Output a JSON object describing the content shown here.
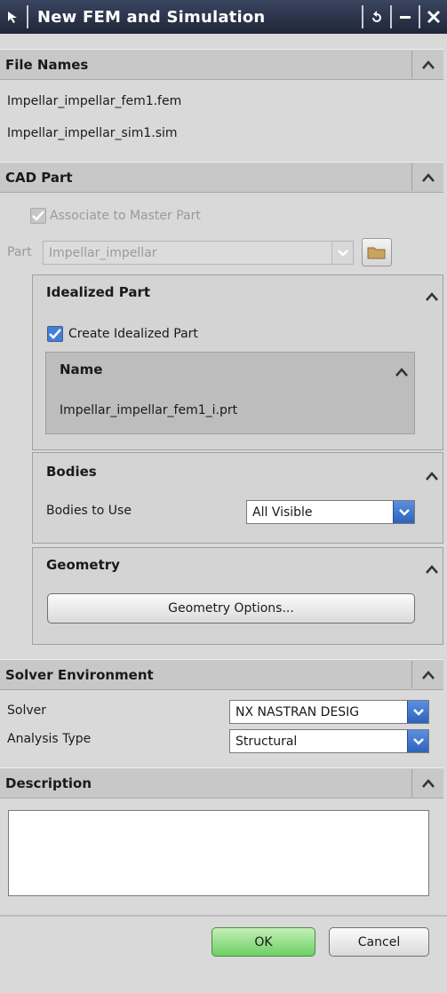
{
  "window": {
    "title": "New FEM and Simulation",
    "title_icon": "pointer-icon",
    "controls": [
      "reset-icon",
      "minimize-icon",
      "close-icon"
    ]
  },
  "file_names": {
    "header": "File Names",
    "fem": "Impellar_impellar_fem1.fem",
    "sim": "Impellar_impellar_sim1.sim"
  },
  "cad_part": {
    "header": "CAD Part",
    "associate_label": "Associate to Master Part",
    "associate_checked": true,
    "part_label": "Part",
    "part_value": "Impellar_impellar"
  },
  "idealized_part": {
    "header": "Idealized Part",
    "create_label": "Create Idealized Part",
    "create_checked": true,
    "name_header": "Name",
    "name_value": "Impellar_impellar_fem1_i.prt"
  },
  "bodies": {
    "header": "Bodies",
    "bodies_label": "Bodies to Use",
    "bodies_value": "All Visible"
  },
  "geometry": {
    "header": "Geometry",
    "options_button": "Geometry Options..."
  },
  "solver_environment": {
    "header": "Solver Environment",
    "solver_label": "Solver",
    "solver_value": "NX NASTRAN DESIG",
    "analysis_label": "Analysis Type",
    "analysis_value": "Structural"
  },
  "description": {
    "header": "Description",
    "value": ""
  },
  "footer": {
    "ok_label": "OK",
    "cancel_label": "Cancel"
  },
  "colors": {
    "titlebar": "#2b3348",
    "accent_blue": "#3f7fd8",
    "ok_green": "#6ccf62",
    "panel_gray": "#d9d9d9"
  }
}
